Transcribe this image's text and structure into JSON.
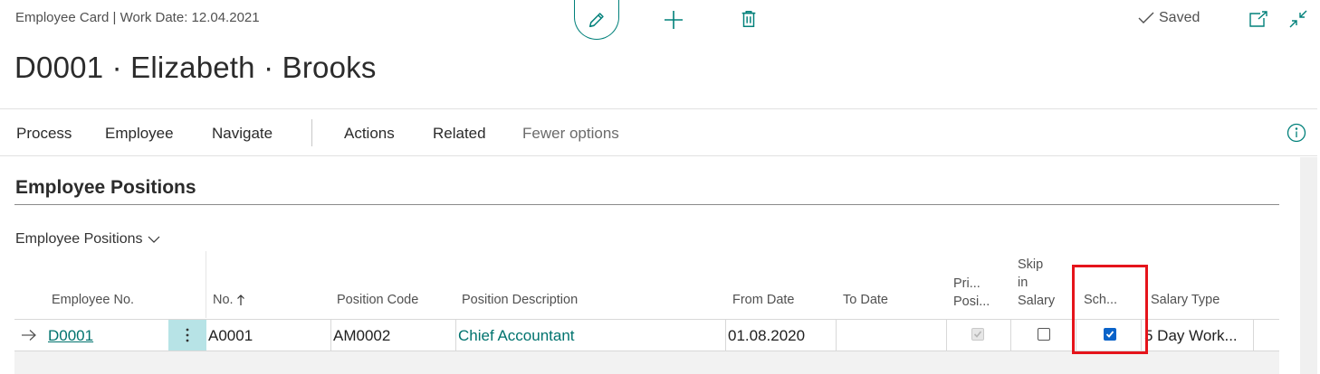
{
  "header": {
    "breadcrumb": "Employee Card | Work Date: 12.04.2021",
    "title": "D0001 · Elizabeth · Brooks",
    "saved_label": "Saved"
  },
  "toolbar": {
    "edit_icon": "pencil-icon",
    "new_icon": "plus-icon",
    "delete_icon": "trash-icon",
    "open_new_window_icon": "open-in-new-window-icon",
    "collapse_icon": "collapse-icon"
  },
  "menu": {
    "items": [
      "Process",
      "Employee",
      "Navigate",
      "Actions",
      "Related",
      "Fewer options"
    ],
    "info_icon": "info-icon"
  },
  "section": {
    "title": "Employee Positions",
    "subpage_title": "Employee Positions"
  },
  "table": {
    "columns": {
      "employee_no": "Employee No.",
      "no": "No.",
      "position_code": "Position Code",
      "position_description": "Position Description",
      "from_date": "From Date",
      "to_date": "To Date",
      "primary_position_l1": "Pri...",
      "primary_position_l2": "Posi...",
      "skip_salary_l1": "Skip",
      "skip_salary_l2": "in",
      "skip_salary_l3": "Salary",
      "schedule": "Sch...",
      "salary_type": "Salary Type"
    },
    "rows": [
      {
        "employee_no": "D0001",
        "no": "A0001",
        "position_code": "AM0002",
        "position_description": "Chief Accountant",
        "from_date": "01.08.2020",
        "to_date": "",
        "primary_position": true,
        "skip_in_salary": false,
        "schedule": true,
        "salary_type": "5 Day Work..."
      }
    ]
  },
  "colors": {
    "accent": "#00807a",
    "link": "#00736e",
    "selected_cell": "#b7e3e6",
    "checkbox_checked": "#0a63c9",
    "highlight": "#e5141b"
  }
}
